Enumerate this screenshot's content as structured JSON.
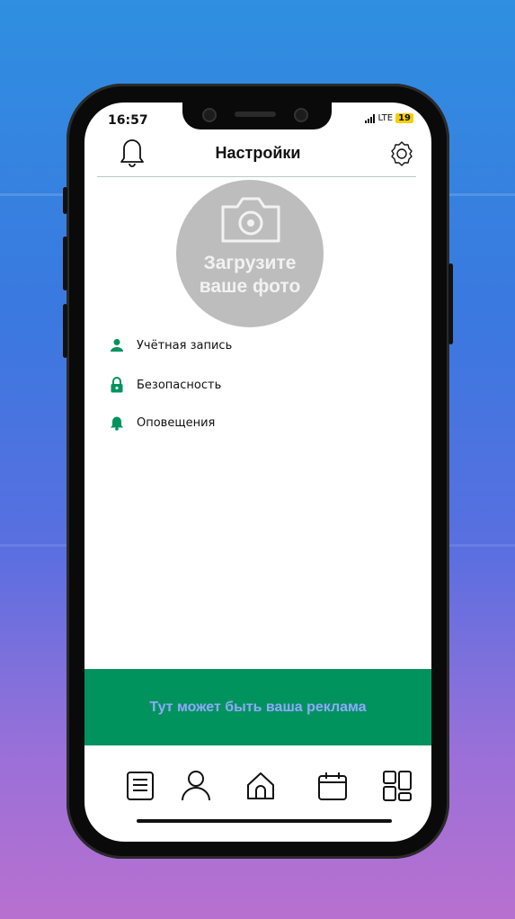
{
  "status_bar": {
    "time": "16:57",
    "network": "LTE",
    "battery": "19"
  },
  "header": {
    "title": "Настройки"
  },
  "avatar": {
    "line1": "Загрузите",
    "line2": "ваше фото"
  },
  "menu": [
    {
      "label": "Учётная запись",
      "icon": "user-icon"
    },
    {
      "label": "Безопасность",
      "icon": "lock-icon"
    },
    {
      "label": "Оповещения",
      "icon": "bell-icon"
    }
  ],
  "ad": {
    "text": "Тут может быть ваша реклама"
  },
  "nav": [
    "list-icon",
    "user-icon",
    "home-icon",
    "calendar-icon",
    "grid-icon"
  ],
  "colors": {
    "accent": "#00935e",
    "ad_text": "#8fa9ff",
    "avatar_bg": "#bdbdbd"
  }
}
